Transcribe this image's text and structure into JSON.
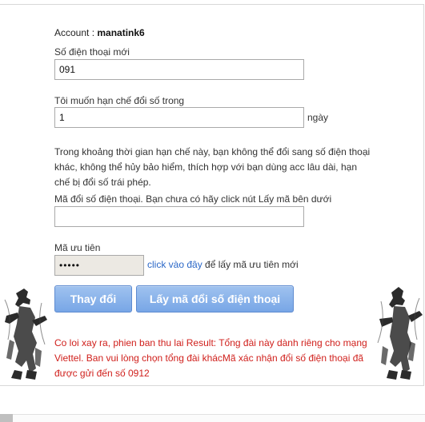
{
  "account": {
    "label": "Account :",
    "username": "manatink6"
  },
  "phone": {
    "label": "Số điện thoại mới",
    "value": "091"
  },
  "limit": {
    "label": "Tôi muốn hạn chế đổi số trong",
    "value": "1",
    "unit": "ngày"
  },
  "note": "Trong khoảng thời gian hạn chế này, bạn không thể đổi sang số điện thoại khác, không thể hủy bảo hiểm, thích hợp với bạn dùng acc lâu dài, hạn chế bị đổi số trái phép.",
  "code": {
    "label": "Mã đổi số điện thoại. Bạn chưa có hãy click nút Lấy mã bên dưới",
    "value": ""
  },
  "priority": {
    "label": "Mã ưu tiên",
    "value": "•••••",
    "link_text": "click vào đây",
    "link_suffix": "để lấy mã ưu tiên mới"
  },
  "buttons": {
    "change": "Thay đổi",
    "get_code": "Lấy mã đổi số điện thoại"
  },
  "error": "Co loi xay ra, phien ban thu lai Result: Tổng đài này dành riêng cho mạng Viettel. Ban vui lòng chọn tổng đài khácMã xác nhận đổi số điện thoại đã được gửi đến số 0912",
  "colors": {
    "error": "#d0201c",
    "link": "#2a67c7",
    "button": "#78a6e6"
  }
}
